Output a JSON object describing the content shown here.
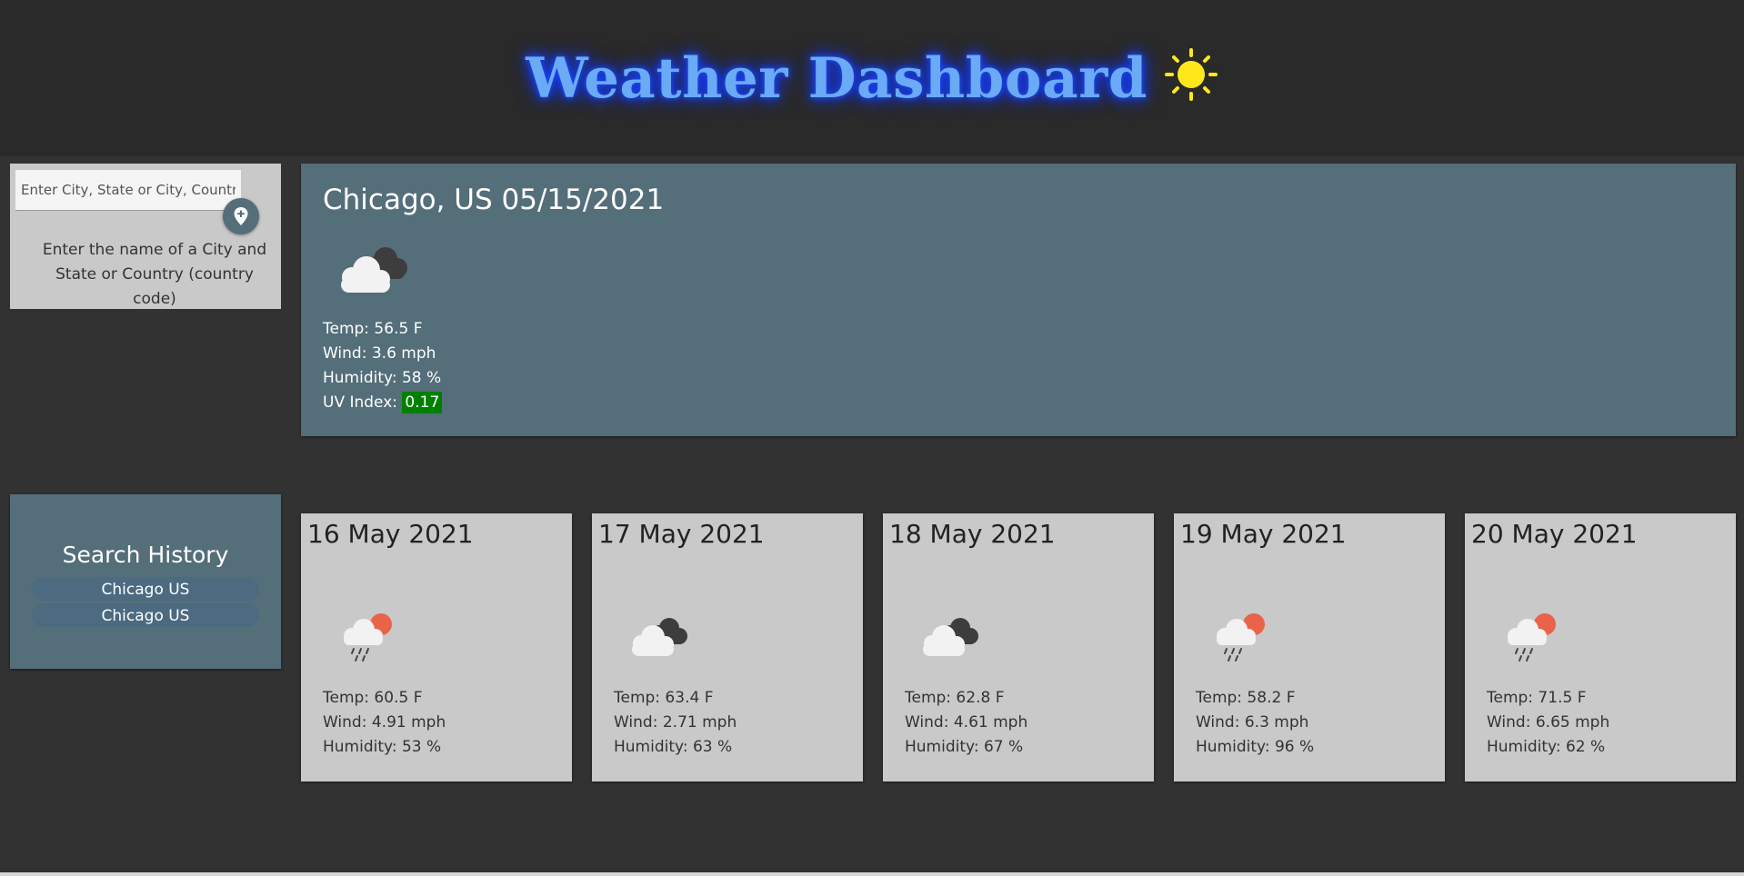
{
  "header": {
    "title": "Weather Dashboard",
    "icon": "sun-icon"
  },
  "search": {
    "placeholder": "Enter City, State or City, Country",
    "help_text": "Enter the name of a City and State or Country (country code)",
    "button_icon": "location-pin-icon"
  },
  "current": {
    "title": "Chicago, US 05/15/2021",
    "icon": "cloudy-icon",
    "temp": "Temp: 56.5 F",
    "wind": "Wind: 3.6 mph",
    "humidity": "Humidity: 58 %",
    "uv_label": "UV Index:",
    "uv_value": "0.17",
    "uv_color": "#008000"
  },
  "history": {
    "title": "Search History",
    "items": [
      "Chicago US",
      "Chicago US"
    ]
  },
  "forecast": [
    {
      "date": "16 May 2021",
      "icon": "sun-rain-icon",
      "temp": "Temp: 60.5 F",
      "wind": "Wind: 4.91 mph",
      "humidity": "Humidity: 53 %"
    },
    {
      "date": "17 May 2021",
      "icon": "cloudy-icon",
      "temp": "Temp: 63.4 F",
      "wind": "Wind: 2.71 mph",
      "humidity": "Humidity: 63 %"
    },
    {
      "date": "18 May 2021",
      "icon": "cloudy-icon",
      "temp": "Temp: 62.8 F",
      "wind": "Wind: 4.61 mph",
      "humidity": "Humidity: 67 %"
    },
    {
      "date": "19 May 2021",
      "icon": "sun-rain-icon",
      "temp": "Temp: 58.2 F",
      "wind": "Wind: 6.3 mph",
      "humidity": "Humidity: 96 %"
    },
    {
      "date": "20 May 2021",
      "icon": "sun-rain-icon",
      "temp": "Temp: 71.5 F",
      "wind": "Wind: 6.65 mph",
      "humidity": "Humidity: 62 %"
    }
  ],
  "colors": {
    "page_bg": "#333233",
    "header_bg": "#2a2a2a",
    "panel_accent": "#546e7a",
    "card_bg": "#c9c9c9",
    "title_glow": "#6aaaf6"
  }
}
